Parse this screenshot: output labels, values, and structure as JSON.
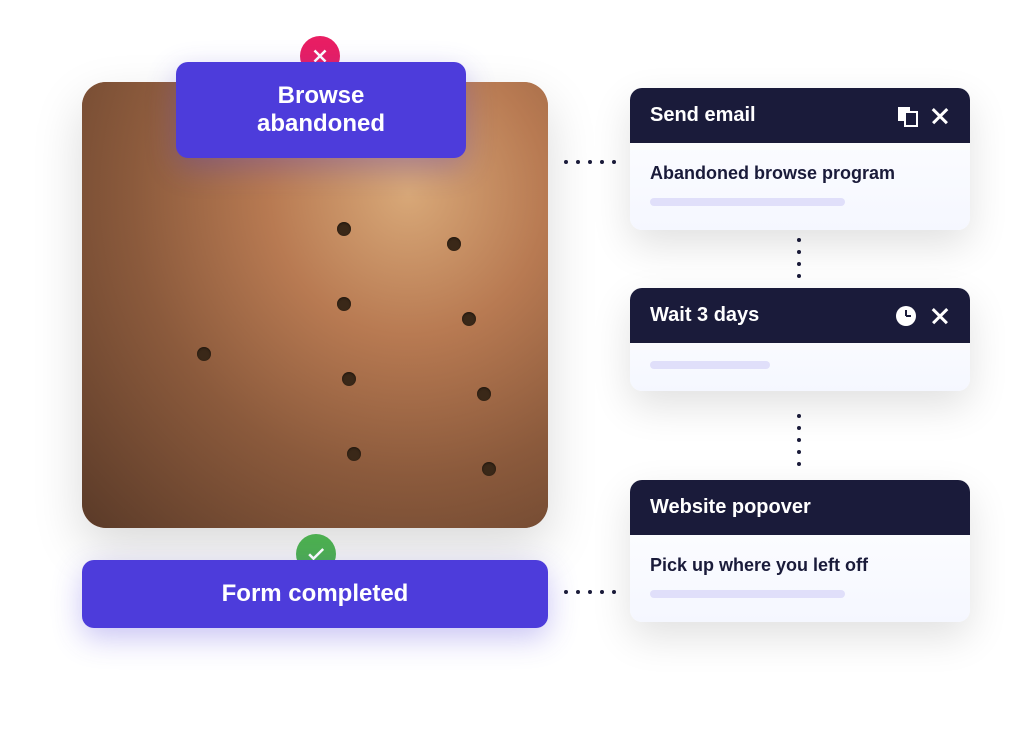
{
  "triggers": {
    "browse_abandoned": "Browse abandoned",
    "form_completed": "Form completed"
  },
  "cards": {
    "email": {
      "title": "Send email",
      "label": "Abandoned browse program"
    },
    "wait": {
      "title": "Wait 3 days"
    },
    "popover": {
      "title": "Website popover",
      "label": "Pick up where you left off"
    }
  },
  "colors": {
    "primary_purple": "#4d3cdb",
    "header_dark": "#1a1b3a",
    "error_red": "#e91e63",
    "success_green": "#4caf50"
  }
}
